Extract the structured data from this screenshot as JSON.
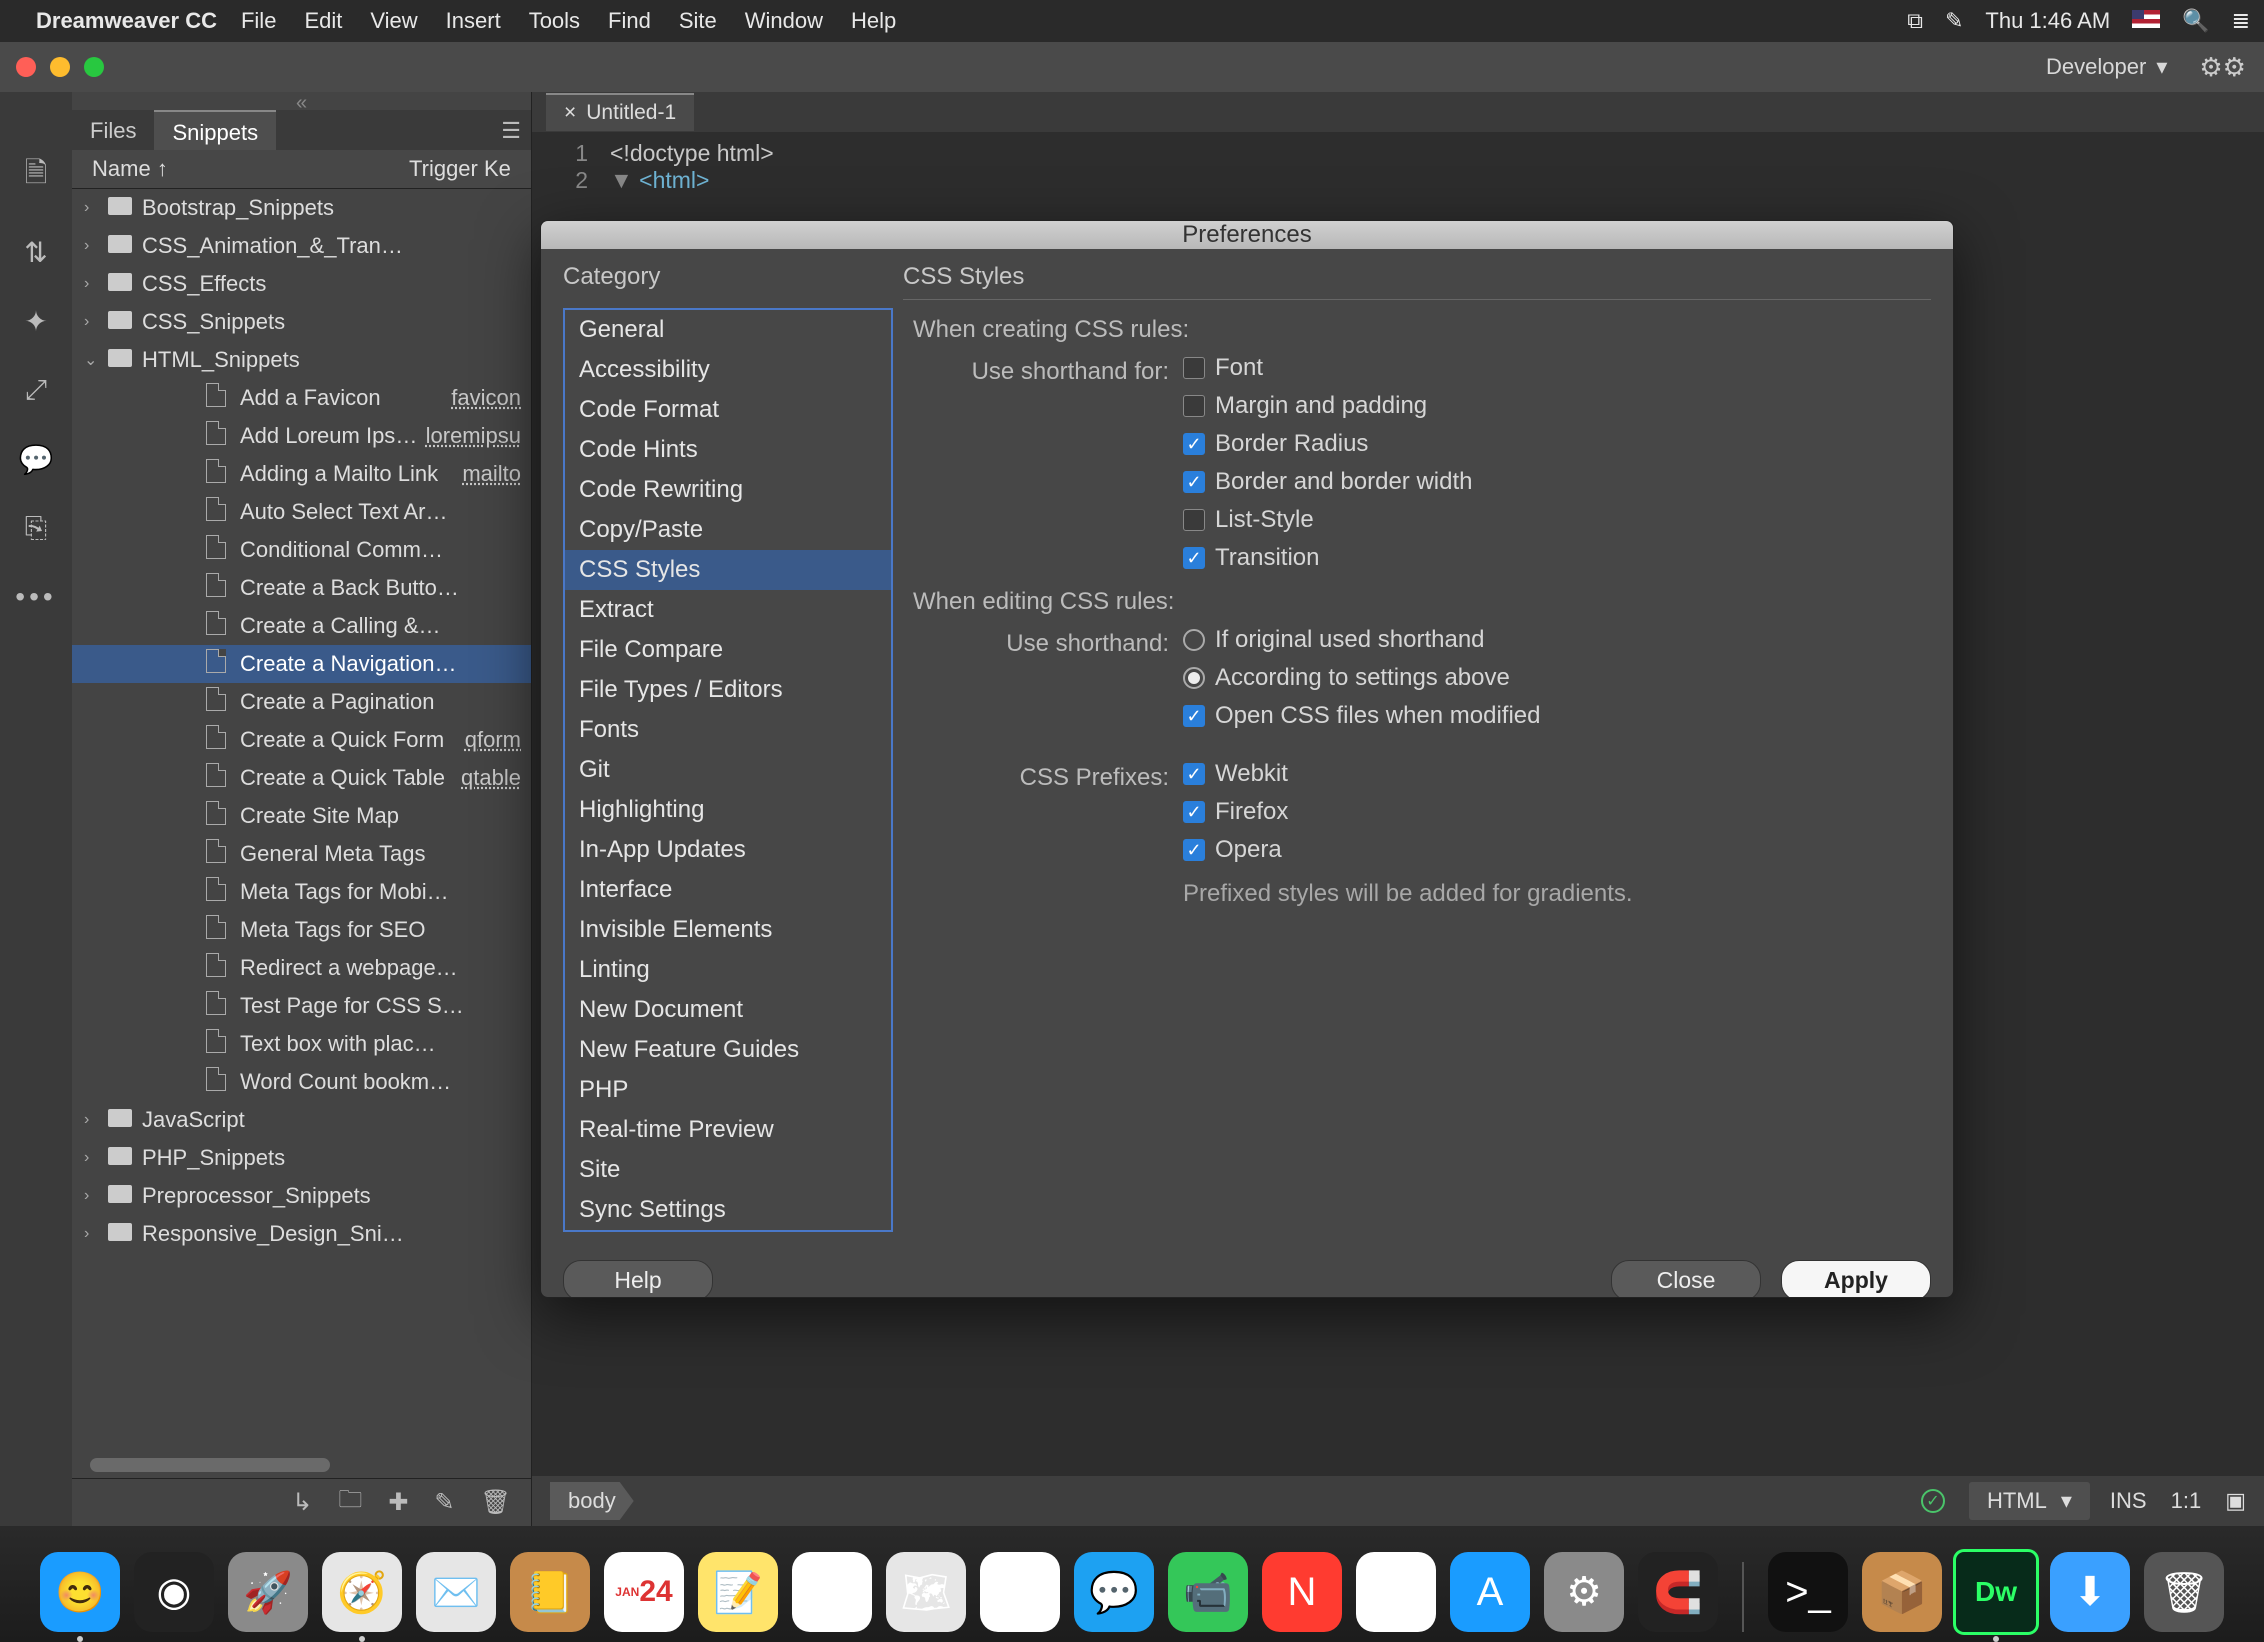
{
  "menubar": {
    "app": "Dreamweaver CC",
    "items": [
      "File",
      "Edit",
      "View",
      "Insert",
      "Tools",
      "Find",
      "Site",
      "Window",
      "Help"
    ],
    "clock": "Thu 1:46 AM"
  },
  "window": {
    "workspace_label": "Developer"
  },
  "sidepanel": {
    "tabs": {
      "files": "Files",
      "snippets": "Snippets"
    },
    "cols": {
      "name": "Name",
      "trigger": "Trigger Ke"
    },
    "folders": [
      {
        "label": "Bootstrap_Snippets",
        "expanded": false
      },
      {
        "label": "CSS_Animation_&_Tran…",
        "expanded": false
      },
      {
        "label": "CSS_Effects",
        "expanded": false
      },
      {
        "label": "CSS_Snippets",
        "expanded": false
      }
    ],
    "html_folder": {
      "label": "HTML_Snippets",
      "expanded": true
    },
    "html_items": [
      {
        "label": "Add a Favicon",
        "tag": "favicon"
      },
      {
        "label": "Add Loreum Ipsum",
        "tag": "loremipsu"
      },
      {
        "label": "Adding a Mailto Link",
        "tag": "mailto"
      },
      {
        "label": "Auto Select Text Ar…",
        "tag": ""
      },
      {
        "label": "Conditional Comm…",
        "tag": ""
      },
      {
        "label": "Create a Back Butto…",
        "tag": ""
      },
      {
        "label": "Create a Calling &…",
        "tag": ""
      },
      {
        "label": "Create a Navigation…",
        "tag": "",
        "selected": true
      },
      {
        "label": "Create a Pagination",
        "tag": ""
      },
      {
        "label": "Create a Quick Form",
        "tag": "qform"
      },
      {
        "label": "Create a Quick Table",
        "tag": "qtable"
      },
      {
        "label": "Create Site Map",
        "tag": ""
      },
      {
        "label": "General Meta Tags",
        "tag": ""
      },
      {
        "label": "Meta Tags for Mobi…",
        "tag": ""
      },
      {
        "label": "Meta Tags for SEO",
        "tag": ""
      },
      {
        "label": "Redirect a webpage…",
        "tag": ""
      },
      {
        "label": "Test Page for CSS S…",
        "tag": ""
      },
      {
        "label": "Text box with plac…",
        "tag": ""
      },
      {
        "label": "Word Count bookm…",
        "tag": ""
      }
    ],
    "rest_folders": [
      {
        "label": "JavaScript"
      },
      {
        "label": "PHP_Snippets"
      },
      {
        "label": "Preprocessor_Snippets"
      },
      {
        "label": "Responsive_Design_Sni…"
      }
    ]
  },
  "editor": {
    "tab_title": "Untitled-1",
    "code_lines": [
      {
        "n": "1",
        "text": "<!doctype html>"
      },
      {
        "n": "2",
        "text": "<html>"
      }
    ]
  },
  "prefs": {
    "title": "Preferences",
    "category_heading": "Category",
    "pane_heading": "CSS Styles",
    "categories": [
      "General",
      "Accessibility",
      "Code Format",
      "Code Hints",
      "Code Rewriting",
      "Copy/Paste",
      "CSS Styles",
      "Extract",
      "File Compare",
      "File Types / Editors",
      "Fonts",
      "Git",
      "Highlighting",
      "In-App Updates",
      "Interface",
      "Invisible Elements",
      "Linting",
      "New Document",
      "New Feature Guides",
      "PHP",
      "Real-time Preview",
      "Site",
      "Sync Settings"
    ],
    "selected_category": "CSS Styles",
    "section_create": "When creating CSS rules:",
    "label_shorthand_for": "Use shorthand for:",
    "shorthand_opts": [
      {
        "label": "Font",
        "checked": false
      },
      {
        "label": "Margin and padding",
        "checked": false
      },
      {
        "label": "Border Radius",
        "checked": true
      },
      {
        "label": "Border and border width",
        "checked": true
      },
      {
        "label": "List-Style",
        "checked": false
      },
      {
        "label": "Transition",
        "checked": true
      }
    ],
    "section_edit": "When editing CSS rules:",
    "label_use_shorthand": "Use shorthand:",
    "radio_opts": [
      {
        "label": "If original used shorthand",
        "on": false
      },
      {
        "label": "According to settings above",
        "on": true
      }
    ],
    "open_css": {
      "label": "Open CSS files when modified",
      "checked": true
    },
    "label_prefixes": "CSS Prefixes:",
    "prefix_opts": [
      {
        "label": "Webkit",
        "checked": true
      },
      {
        "label": "Firefox",
        "checked": true
      },
      {
        "label": "Opera",
        "checked": true
      }
    ],
    "prefix_note": "Prefixed styles will be added for gradients.",
    "buttons": {
      "help": "Help",
      "close": "Close",
      "apply": "Apply"
    }
  },
  "statusbar": {
    "crumb": "body",
    "lang": "HTML",
    "ins": "INS",
    "pos": "1:1"
  },
  "dock": [
    {
      "name": "finder",
      "bg": "#1a9cff",
      "glyph": "😊",
      "running": true
    },
    {
      "name": "siri",
      "bg": "#222",
      "glyph": "◉",
      "running": false
    },
    {
      "name": "launchpad",
      "bg": "#8a8a8a",
      "glyph": "🚀",
      "running": false
    },
    {
      "name": "safari",
      "bg": "#e6e6e6",
      "glyph": "🧭",
      "running": true
    },
    {
      "name": "mail",
      "bg": "#e6e6e6",
      "glyph": "✉️",
      "running": false
    },
    {
      "name": "contacts",
      "bg": "#c68a4a",
      "glyph": "📒",
      "running": false
    },
    {
      "name": "calendar",
      "bg": "#fff",
      "glyph": "24",
      "running": false
    },
    {
      "name": "notes",
      "bg": "#ffe46b",
      "glyph": "📝",
      "running": false
    },
    {
      "name": "reminders",
      "bg": "#fff",
      "glyph": "☑︎",
      "running": false
    },
    {
      "name": "maps",
      "bg": "#e6e6e6",
      "glyph": "🗺",
      "running": false
    },
    {
      "name": "photos",
      "bg": "#fff",
      "glyph": "❀",
      "running": false
    },
    {
      "name": "messages",
      "bg": "#1da1f2",
      "glyph": "💬",
      "running": false
    },
    {
      "name": "facetime",
      "bg": "#34c759",
      "glyph": "📹",
      "running": false
    },
    {
      "name": "news",
      "bg": "#ff3b30",
      "glyph": "N",
      "running": false
    },
    {
      "name": "itunes",
      "bg": "#fff",
      "glyph": "♪",
      "running": false
    },
    {
      "name": "appstore",
      "bg": "#1a9cff",
      "glyph": "A",
      "running": false
    },
    {
      "name": "settings",
      "bg": "#8a8a8a",
      "glyph": "⚙︎",
      "running": false
    },
    {
      "name": "magnet",
      "bg": "#222",
      "glyph": "🧲",
      "running": false
    },
    {
      "name": "sep",
      "sep": true
    },
    {
      "name": "terminal",
      "bg": "#111",
      "glyph": ">_",
      "running": false
    },
    {
      "name": "box",
      "bg": "#c68a4a",
      "glyph": "📦",
      "running": false
    },
    {
      "name": "dreamweaver",
      "bg": "#072b1a",
      "glyph": "Dw",
      "running": true,
      "hl": true
    },
    {
      "name": "downloads",
      "bg": "#3aa0ff",
      "glyph": "⬇︎",
      "running": false
    },
    {
      "name": "trash",
      "bg": "#555",
      "glyph": "🗑",
      "running": false
    }
  ]
}
